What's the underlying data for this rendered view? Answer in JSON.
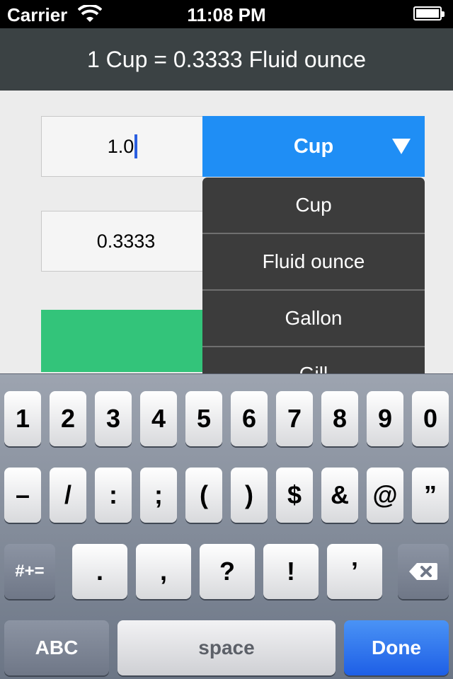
{
  "status_bar": {
    "carrier": "Carrier",
    "time": "11:08 PM",
    "wifi_icon": "wifi-icon",
    "battery_icon": "battery-icon"
  },
  "header": {
    "title": "1 Cup = 0.3333 Fluid ounce"
  },
  "converter": {
    "input_value": "1.0",
    "selected_unit": "Cup",
    "dropdown_icon": "triangle-down-icon",
    "output_value": "0.3333",
    "accent_color": "#1f8ef5",
    "action_color": "#33c47a"
  },
  "dropdown": {
    "items": [
      "Cup",
      "Fluid ounce",
      "Gallon",
      "Gill"
    ]
  },
  "keyboard": {
    "row1": [
      "1",
      "2",
      "3",
      "4",
      "5",
      "6",
      "7",
      "8",
      "9",
      "0"
    ],
    "row2": [
      "–",
      "/",
      ":",
      ";",
      "(",
      ")",
      "$",
      "&",
      "@",
      "”"
    ],
    "row3": [
      "#+=",
      ".",
      ",",
      "?",
      "!",
      "’"
    ],
    "delete_icon": "backspace-icon",
    "abc_label": "ABC",
    "space_label": "space",
    "done_label": "Done"
  }
}
